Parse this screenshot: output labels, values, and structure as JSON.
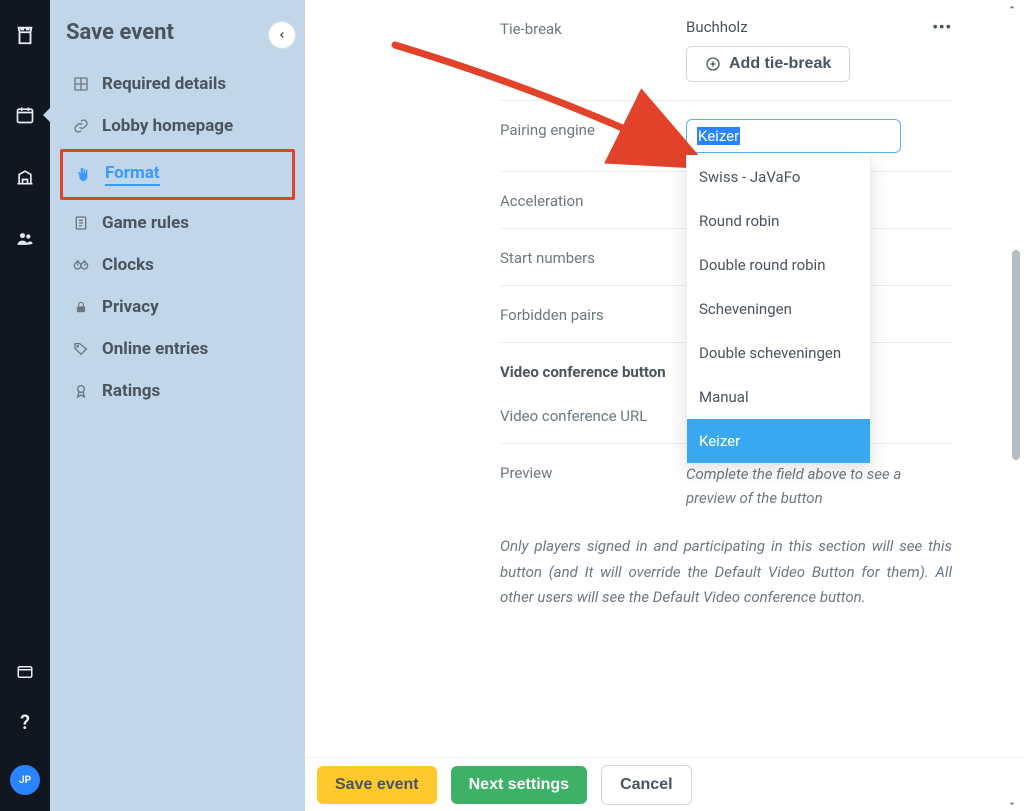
{
  "iconbar": {
    "avatar": "JP"
  },
  "sidebar": {
    "title": "Save event",
    "items": [
      {
        "label": "Required details"
      },
      {
        "label": "Lobby homepage"
      },
      {
        "label": "Format",
        "active": true,
        "highlighted": true
      },
      {
        "label": "Game rules"
      },
      {
        "label": "Clocks"
      },
      {
        "label": "Privacy"
      },
      {
        "label": "Online entries"
      },
      {
        "label": "Ratings"
      }
    ]
  },
  "form": {
    "tie_break": {
      "label": "Tie-break",
      "value": "Buchholz",
      "add_button": "Add tie-break"
    },
    "pairing_engine": {
      "label": "Pairing engine",
      "value": "Keizer",
      "options": [
        "Swiss - JaVaFo",
        "Round robin",
        "Double round robin",
        "Scheveningen",
        "Double scheveningen",
        "Manual",
        "Keizer"
      ],
      "selected": "Keizer"
    },
    "acceleration": {
      "label": "Acceleration"
    },
    "start_numbers": {
      "label": "Start numbers"
    },
    "forbidden_pairs": {
      "label": "Forbidden pairs"
    },
    "video_button_heading": "Video conference button",
    "video_url": {
      "label": "Video conference URL"
    },
    "preview": {
      "label": "Preview",
      "hint": "Complete the field above to see a preview of the button"
    },
    "note": "Only players signed in and participating in this section will see this button (and It will override the Default Video Button for them). All other users will see the Default Video conference button."
  },
  "footer": {
    "save": "Save event",
    "next": "Next settings",
    "cancel": "Cancel"
  },
  "colors": {
    "annotation": "#e2422a"
  }
}
